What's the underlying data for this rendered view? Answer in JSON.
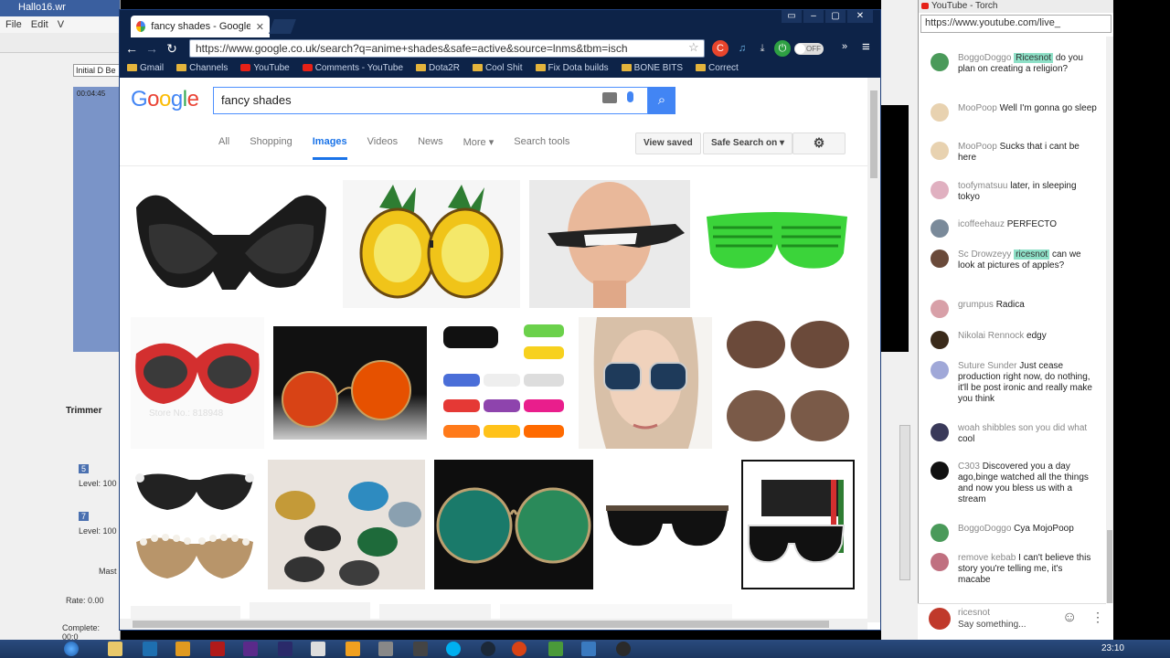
{
  "editor": {
    "title": "Hallo16.wr",
    "menu": [
      "File",
      "Edit",
      "V"
    ],
    "initial_label": "Initial D Be",
    "time": "00:04:45",
    "trimmer": "Trimmer",
    "track1": "5",
    "track1_level": "Level: 100",
    "track2": "7",
    "track2_level": "Level: 100",
    "master": "Mast",
    "rate": "Rate: 0.00",
    "complete": "Complete: 00:0"
  },
  "chrome": {
    "tab_title": "fancy shades - Google Se",
    "tab_close": "✕",
    "url": "https://www.google.co.uk/search?q=anime+shades&safe=active&source=lnms&tbm=isch",
    "toggle_label": "OFF",
    "window_buttons": [
      "▭",
      "–",
      "▢",
      "✕"
    ],
    "bookmarks": [
      {
        "label": "Gmail",
        "kind": "folder"
      },
      {
        "label": "Channels",
        "kind": "folder"
      },
      {
        "label": "YouTube",
        "kind": "yt"
      },
      {
        "label": "Comments - YouTube",
        "kind": "yt"
      },
      {
        "label": "Dota2R",
        "kind": "folder"
      },
      {
        "label": "Cool Shit",
        "kind": "folder"
      },
      {
        "label": "Fix Dota builds",
        "kind": "folder"
      },
      {
        "label": "BONE BITS",
        "kind": "folder"
      },
      {
        "label": "Correct",
        "kind": "folder"
      }
    ]
  },
  "google": {
    "logo": [
      "G",
      "o",
      "o",
      "g",
      "l",
      "e"
    ],
    "logo_colors": [
      "#4285f4",
      "#ea4335",
      "#fbbc05",
      "#4285f4",
      "#34a853",
      "#ea4335"
    ],
    "query": "fancy shades",
    "tabs": [
      "All",
      "Shopping",
      "Images",
      "Videos",
      "News",
      "More ▾",
      "Search tools"
    ],
    "active_tab": "Images",
    "view_saved": "View saved",
    "safe_search": "Safe Search on ▾",
    "settings_icon": "⚙",
    "search_icon": "⌕",
    "watermarks": [
      "Store No.: 818948"
    ]
  },
  "youtube": {
    "window_title": "YouTube - Torch",
    "url": "https://www.youtube.com/live_",
    "messages": [
      {
        "author": "BoggoDoggo",
        "text": "Ricesnot do you plan on creating a religion?",
        "mention": "Ricesnot",
        "body": "do you plan on creating a religion?",
        "color": "#4a9a5a"
      },
      {
        "author": "MooPoop",
        "text": "Well I'm gonna go sleep",
        "body": "Well I'm gonna go sleep",
        "color": "#e8d2b0"
      },
      {
        "author": "MooPoop",
        "text": "Sucks that i cant be here",
        "body": "Sucks that i cant be here",
        "color": "#e8d2b0"
      },
      {
        "author": "toofymatsuu",
        "text": "later, in sleeping tokyo",
        "body": "later, in sleeping tokyo",
        "color": "#e0b0c0"
      },
      {
        "author": "icoffeehauz",
        "text": "PERFECTO",
        "body": "PERFECTO",
        "color": "#7a8a9a"
      },
      {
        "author": "Sc Drowzeyy",
        "text": "ricesnot can we look at pictures of apples?",
        "mention": "ricesnot",
        "body": "can we look at pictures of apples?",
        "color": "#6a4a3a"
      },
      {
        "author": "grumpus",
        "text": "Radica",
        "body": "Radica",
        "color": "#d8a0a8"
      },
      {
        "author": "Nikolai Rennock",
        "text": "edgy",
        "body": "edgy",
        "color": "#3a2a1a"
      },
      {
        "author": "Suture Sunder",
        "text": "Just cease production right now, do nothing, it'll be post ironic and really make you think",
        "body": "Just cease production right now, do nothing, it'll be post ironic and really make you think",
        "color": "#a0a8d8"
      },
      {
        "author": "woah shibbles son you did what",
        "text": "cool",
        "body": "cool",
        "color": "#3a3a5a"
      },
      {
        "author": "C303",
        "text": "Discovered you a day ago,binge watched all the things and now you bless us with a stream",
        "body": "Discovered you a day ago,binge watched all the things and now you bless us with a stream",
        "color": "#111"
      },
      {
        "author": "BoggoDoggo",
        "text": "Cya MojoPoop",
        "body": "Cya MojoPoop",
        "color": "#4a9a5a"
      },
      {
        "author": "remove kebab",
        "text": "I can't believe this story you're telling me, it's macabe",
        "body": "I can't believe this story you're telling me, it's macabe",
        "color": "#c07080"
      }
    ],
    "input_user": "ricesnot",
    "input_placeholder": "Say something..."
  },
  "taskbar": {
    "clock": "23:10"
  }
}
